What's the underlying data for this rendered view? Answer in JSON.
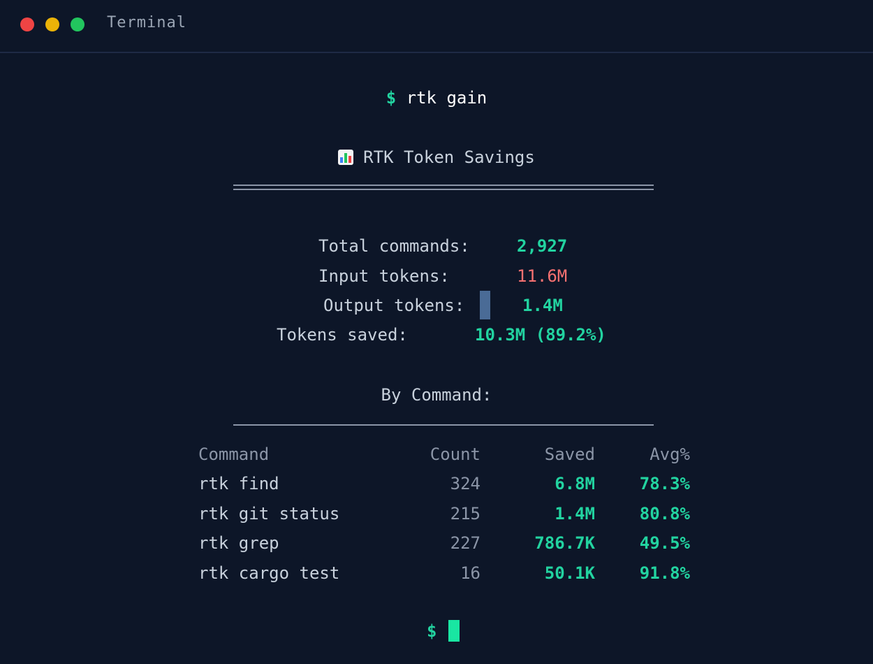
{
  "window": {
    "title": "Terminal"
  },
  "command_line": {
    "prompt": "$",
    "command": "rtk gain"
  },
  "report": {
    "icon": "bar-chart-icon",
    "title": "RTK Token Savings",
    "stats": {
      "total_commands_label": "Total commands:",
      "total_commands_value": "2,927",
      "input_tokens_label": "Input tokens:",
      "input_tokens_value": "11.6M",
      "output_tokens_label": "Output tokens:",
      "output_tokens_value": "1.4M",
      "tokens_saved_label": "Tokens saved:",
      "tokens_saved_value": "10.3M (89.2%)"
    },
    "by_command_heading": "By Command:",
    "table": {
      "headers": [
        "Command",
        "Count",
        "Saved",
        "Avg%"
      ],
      "rows": [
        [
          "rtk find",
          "324",
          "6.8M",
          "78.3%"
        ],
        [
          "rtk git status",
          "215",
          "1.4M",
          "80.8%"
        ],
        [
          "rtk grep",
          "227",
          "786.7K",
          "49.5%"
        ],
        [
          "rtk cargo test",
          "16",
          "50.1K",
          "91.8%"
        ]
      ]
    }
  },
  "final_prompt": "$",
  "colors": {
    "background": "#0d1628",
    "accent_green": "#22d3a0",
    "input_red": "#f87171",
    "cursor": "#19e6a2"
  }
}
